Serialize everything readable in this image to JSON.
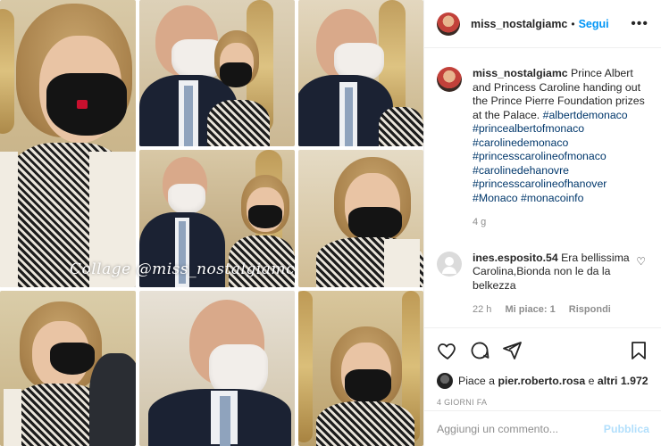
{
  "media": {
    "watermark": "Collage  @miss_nostalgiamc"
  },
  "header": {
    "username": "miss_nostalgiamc",
    "separator": "•",
    "follow_label": "Segui",
    "more_label": "•••"
  },
  "caption": {
    "username": "miss_nostalgiamc",
    "text": "Prince Albert and Princess Caroline handing out the Prince Pierre Foundation prizes at the Palace.",
    "hashtags": [
      "#albertdemonaco",
      "#princealbertofmonaco",
      "#carolinedemonaco",
      "#princesscarolineofmonaco",
      "#carolinedehanovre",
      "#princesscarolineofhanover",
      "#Monaco",
      "#monacoinfo"
    ],
    "time": "4 g"
  },
  "comment": {
    "username": "ines.esposito.54",
    "text": "Era bellissima Carolina,Bionda non le da la belkezza",
    "time": "22 h",
    "likes": "Mi piace: 1",
    "reply": "Rispondi"
  },
  "actions": {
    "like_icon": "heart-icon",
    "comment_icon": "comment-icon",
    "share_icon": "paper-plane-icon",
    "save_icon": "bookmark-icon"
  },
  "likes": {
    "prefix": "Piace a",
    "user": "pier.roberto.rosa",
    "middle": "e",
    "others": "altri 1.972"
  },
  "date": "4 GIORNI FA",
  "add_comment": {
    "placeholder": "Aggiungi un commento...",
    "publish_label": "Pubblica"
  },
  "colors": {
    "link": "#00376b",
    "follow": "#0095f6",
    "publish_disabled": "#b2dffc",
    "muted": "#8e8e8e"
  }
}
